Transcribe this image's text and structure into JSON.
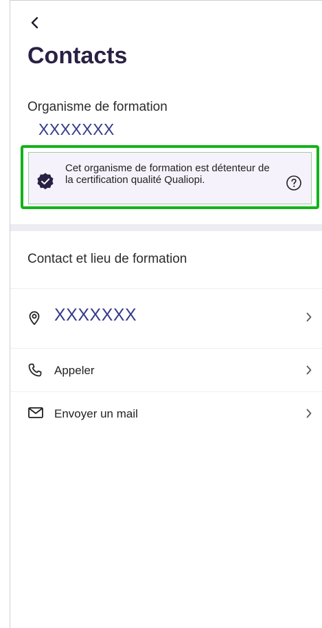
{
  "header": {
    "back_icon": "chevron-left-icon",
    "title": "Contacts"
  },
  "organisme": {
    "label": "Organisme de formation",
    "value": "XXXXXXX",
    "certification": {
      "icon": "badge-check-icon",
      "text": "Cet organisme de formation est détenteur de la certification qualité Qualiopi.",
      "help_icon": "question-circle-icon",
      "highlight_color": "#12b31a",
      "background_color": "#f6f2fb"
    }
  },
  "contact": {
    "section_title": "Contact et lieu de formation",
    "location": {
      "icon": "map-pin-icon",
      "label": "XXXXXXX"
    },
    "call": {
      "icon": "phone-icon",
      "label": "Appeler"
    },
    "mail": {
      "icon": "mail-icon",
      "label": "Envoyer un mail"
    }
  },
  "colors": {
    "title": "#2b2144",
    "accent_text": "#343a8a",
    "divider": "#ececf1"
  }
}
